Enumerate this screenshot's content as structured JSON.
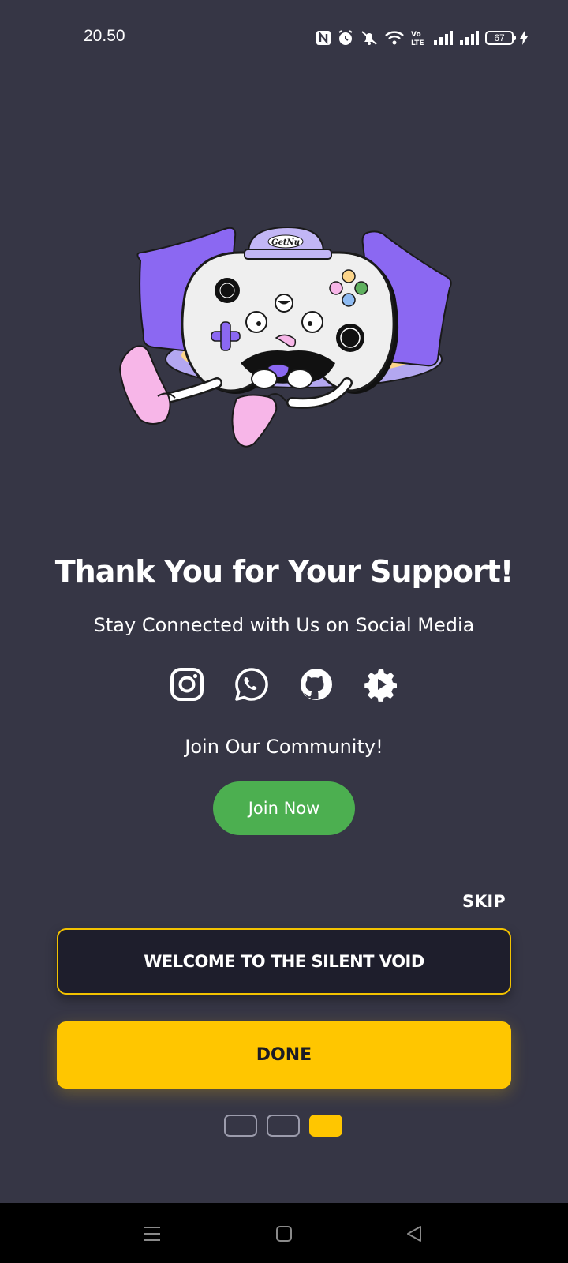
{
  "status_bar": {
    "time": "20.50",
    "battery_level": "67",
    "icons": [
      "nfc-icon",
      "alarm-icon",
      "mute-icon",
      "wifi-icon",
      "volte-icon",
      "signal-icon",
      "signal-icon",
      "battery-icon",
      "charging-icon"
    ]
  },
  "main": {
    "headline": "Thank You for Your Support!",
    "subhead": "Stay Connected with Us on Social Media",
    "social_icons": [
      "instagram-icon",
      "whatsapp-icon",
      "github-icon",
      "settings-gear-icon"
    ],
    "community_text": "Join Our Community!",
    "join_button_label": "Join Now",
    "mascot_cap_text": "GetNu"
  },
  "onboarding": {
    "skip_label": "SKIP",
    "welcome_text": "WELCOME TO THE SILENT VOID",
    "done_label": "DONE",
    "page_indicator": {
      "total": 3,
      "current": 3
    }
  },
  "colors": {
    "background": "#363645",
    "accent": "#ffc600",
    "join_button": "#4caf50",
    "welcome_box": "#1e1e2c"
  }
}
